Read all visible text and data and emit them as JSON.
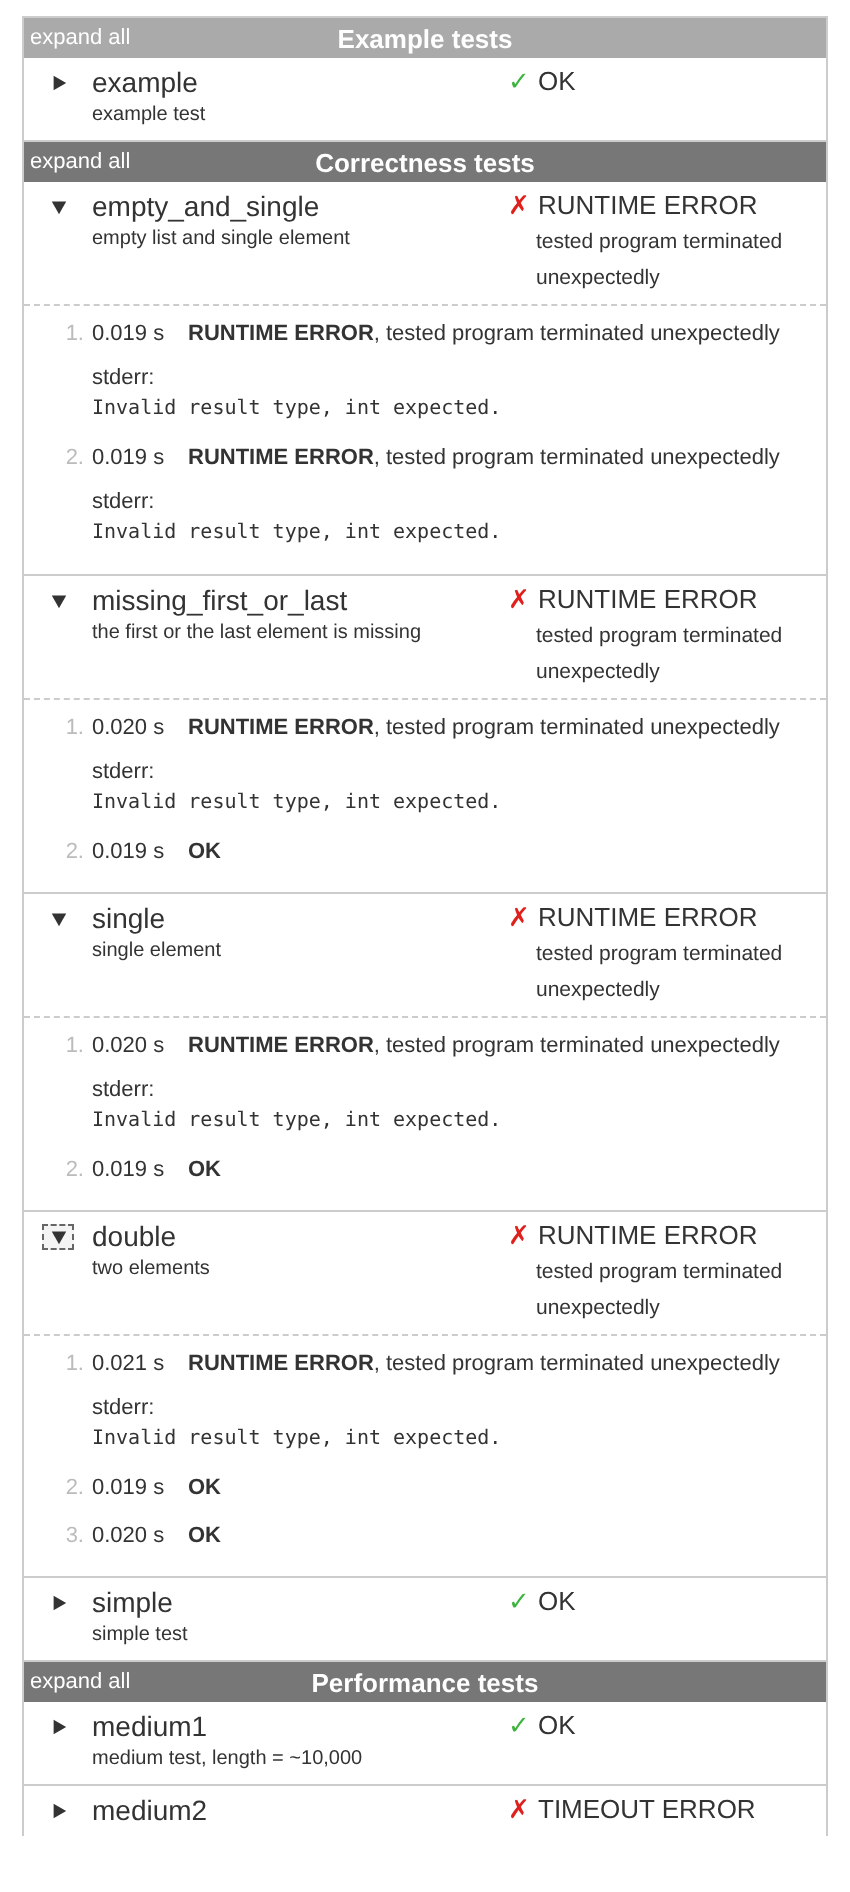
{
  "sections": [
    {
      "expand_label": "expand all",
      "title": "Example tests",
      "color": "#aaaaaa",
      "tests": [
        {
          "name": "example",
          "description": "example test",
          "expanded": false,
          "focused": false,
          "kind": "ok",
          "status_icon": "✓",
          "status_text": "OK"
        }
      ]
    },
    {
      "expand_label": "expand all",
      "title": "Correctness tests",
      "color": "#777777",
      "tests": [
        {
          "name": "empty_and_single",
          "description": "empty list and single element",
          "expanded": true,
          "focused": false,
          "kind": "error",
          "status_icon": "✗",
          "status_text": "RUNTIME ERROR",
          "status_detail": "tested program terminated unexpectedly",
          "runs": [
            {
              "number": "1.",
              "time": "0.019 s",
              "kind": "error",
              "result": "**RUNTIME ERROR**, tested program terminated unexpectedly",
              "stderr_label": "stderr:",
              "stderr": "Invalid result type, int expected."
            },
            {
              "number": "2.",
              "time": "0.019 s",
              "kind": "error",
              "result": "**RUNTIME ERROR**, tested program terminated unexpectedly",
              "stderr_label": "stderr:",
              "stderr": "Invalid result type, int expected."
            }
          ]
        },
        {
          "name": "missing_first_or_last",
          "description": "the first or the last element is missing",
          "expanded": true,
          "focused": false,
          "kind": "error",
          "status_icon": "✗",
          "status_text": "RUNTIME ERROR",
          "status_detail": "tested program terminated unexpectedly",
          "runs": [
            {
              "number": "1.",
              "time": "0.020 s",
              "kind": "error",
              "result": "**RUNTIME ERROR**, tested program terminated unexpectedly",
              "stderr_label": "stderr:",
              "stderr": "Invalid result type, int expected."
            },
            {
              "number": "2.",
              "time": "0.019 s",
              "kind": "ok",
              "result": "OK"
            }
          ]
        },
        {
          "name": "single",
          "description": "single element",
          "expanded": true,
          "focused": false,
          "kind": "error",
          "status_icon": "✗",
          "status_text": "RUNTIME ERROR",
          "status_detail": "tested program terminated unexpectedly",
          "runs": [
            {
              "number": "1.",
              "time": "0.020 s",
              "kind": "error",
              "result": "**RUNTIME ERROR**, tested program terminated unexpectedly",
              "stderr_label": "stderr:",
              "stderr": "Invalid result type, int expected."
            },
            {
              "number": "2.",
              "time": "0.019 s",
              "kind": "ok",
              "result": "OK"
            }
          ]
        },
        {
          "name": "double",
          "description": "two elements",
          "expanded": true,
          "focused": true,
          "kind": "error",
          "status_icon": "✗",
          "status_text": "RUNTIME ERROR",
          "status_detail": "tested program terminated unexpectedly",
          "runs": [
            {
              "number": "1.",
              "time": "0.021 s",
              "kind": "error",
              "result": "**RUNTIME ERROR**, tested program terminated unexpectedly",
              "stderr_label": "stderr:",
              "stderr": "Invalid result type, int expected."
            },
            {
              "number": "2.",
              "time": "0.019 s",
              "kind": "ok",
              "result": "OK"
            },
            {
              "number": "3.",
              "time": "0.020 s",
              "kind": "ok",
              "result": "OK"
            }
          ]
        },
        {
          "name": "simple",
          "description": "simple test",
          "expanded": false,
          "focused": false,
          "kind": "ok",
          "status_icon": "✓",
          "status_text": "OK"
        }
      ]
    },
    {
      "expand_label": "expand all",
      "title": "Performance tests",
      "color": "#777777",
      "tests": [
        {
          "name": "medium1",
          "description": "medium test, length = ~10,000",
          "expanded": false,
          "focused": false,
          "kind": "ok",
          "status_icon": "✓",
          "status_text": "OK"
        },
        {
          "name": "medium2",
          "expanded": false,
          "focused": false,
          "kind": "error",
          "status_icon": "✗",
          "status_text": "TIMEOUT ERROR"
        }
      ]
    }
  ]
}
